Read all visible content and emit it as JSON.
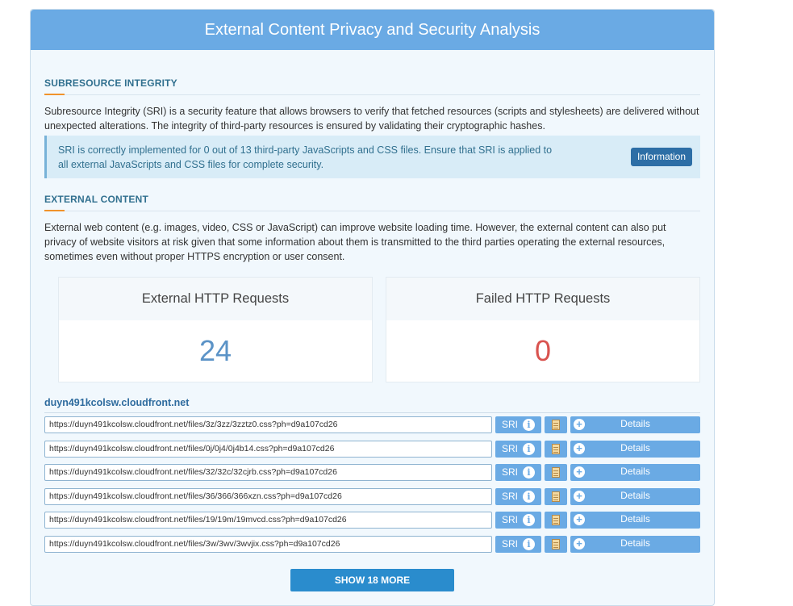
{
  "header": {
    "title": "External Content Privacy and Security Analysis"
  },
  "sri": {
    "title": "SUBRESOURCE INTEGRITY",
    "description": "Subresource Integrity (SRI) is a security feature that allows browsers to verify that fetched resources (scripts and stylesheets) are delivered without unexpected alterations. The integrity of third-party resources is ensured by validating their cryptographic hashes.",
    "info_message": "SRI is correctly implemented for 0 out of 13 third-party JavaScripts and CSS files. Ensure that SRI is applied to all external JavaScripts and CSS files for complete security.",
    "info_button": "Information"
  },
  "external": {
    "title": "EXTERNAL CONTENT",
    "description": "External web content (e.g. images, video, CSS or JavaScript) can improve website loading time. However, the external content can also put privacy of website visitors at risk given that some information about them is transmitted to the third parties operating the external resources, sometimes even without proper HTTPS encryption or user consent."
  },
  "stats": {
    "external_label": "External HTTP Requests",
    "external_value": "24",
    "external_color": "#5b93c7",
    "failed_label": "Failed HTTP Requests",
    "failed_value": "0",
    "failed_color": "#d9534f"
  },
  "host": "duyn491kcolsw.cloudfront.net",
  "resources": [
    {
      "url": "https://duyn491kcolsw.cloudfront.net/files/3z/3zz/3zztz0.css?ph=d9a107cd26",
      "sri_label": "SRI",
      "details_label": "Details"
    },
    {
      "url": "https://duyn491kcolsw.cloudfront.net/files/0j/0j4/0j4b14.css?ph=d9a107cd26",
      "sri_label": "SRI",
      "details_label": "Details"
    },
    {
      "url": "https://duyn491kcolsw.cloudfront.net/files/32/32c/32cjrb.css?ph=d9a107cd26",
      "sri_label": "SRI",
      "details_label": "Details"
    },
    {
      "url": "https://duyn491kcolsw.cloudfront.net/files/36/366/366xzn.css?ph=d9a107cd26",
      "sri_label": "SRI",
      "details_label": "Details"
    },
    {
      "url": "https://duyn491kcolsw.cloudfront.net/files/19/19m/19mvcd.css?ph=d9a107cd26",
      "sri_label": "SRI",
      "details_label": "Details"
    },
    {
      "url": "https://duyn491kcolsw.cloudfront.net/files/3w/3wv/3wvjix.css?ph=d9a107cd26",
      "sri_label": "SRI",
      "details_label": "Details"
    }
  ],
  "show_more_label": "SHOW 18 MORE",
  "icons": {
    "sri_info": "info-icon",
    "document": "document-icon",
    "expand": "plus-icon"
  }
}
